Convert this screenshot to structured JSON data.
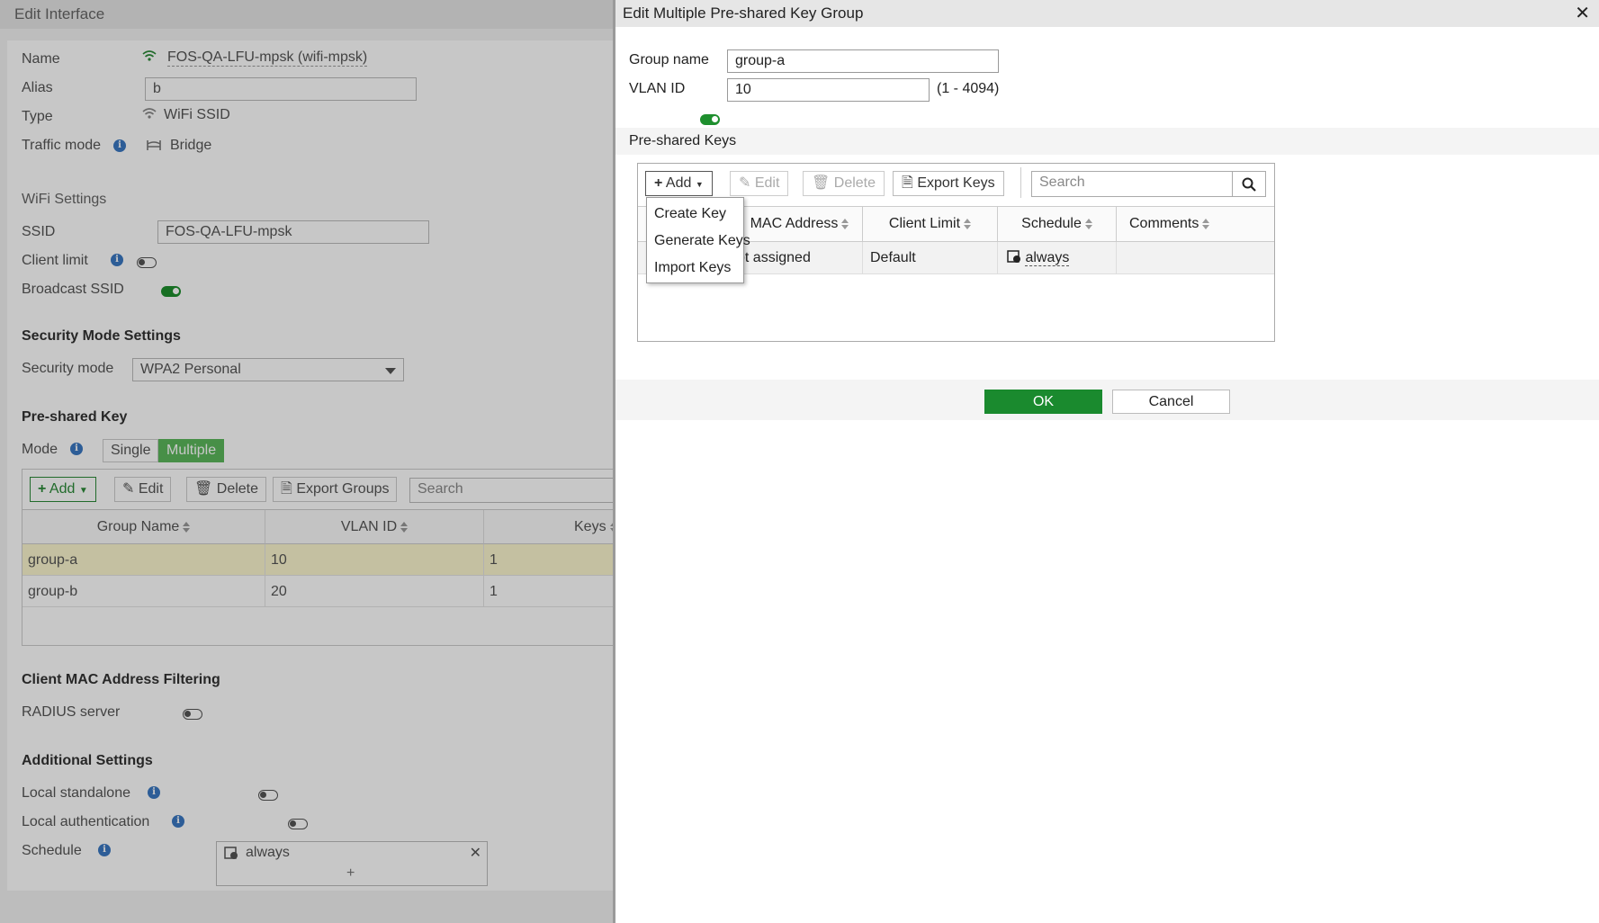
{
  "background_page": {
    "title": "Edit Interface",
    "name": {
      "label": "Name",
      "value": "FOS-QA-LFU-mpsk (wifi-mpsk)"
    },
    "alias": {
      "label": "Alias",
      "value": "b"
    },
    "type": {
      "label": "Type",
      "value": "WiFi SSID"
    },
    "traffic_mode": {
      "label": "Traffic mode",
      "value": "Bridge"
    },
    "wifi_settings": {
      "title": "WiFi Settings",
      "ssid": {
        "label": "SSID",
        "value": "FOS-QA-LFU-mpsk"
      },
      "client_limit": {
        "label": "Client limit",
        "enabled": false
      },
      "broadcast_ssid": {
        "label": "Broadcast SSID",
        "enabled": true
      }
    },
    "security_mode_settings": {
      "title": "Security Mode Settings",
      "security_mode": {
        "label": "Security mode",
        "value": "WPA2 Personal"
      }
    },
    "pre_shared_key": {
      "title": "Pre-shared Key",
      "mode_label": "Mode",
      "mode_options": [
        "Single",
        "Multiple"
      ],
      "mode_selected": "Multiple",
      "toolbar": {
        "add": "Add",
        "edit": "Edit",
        "delete": "Delete",
        "export": "Export Groups",
        "search_placeholder": "Search"
      },
      "columns": [
        "Group Name",
        "VLAN ID",
        "Keys"
      ],
      "rows": [
        {
          "group_name": "group-a",
          "vlan_id": "10",
          "keys": "1",
          "selected": true
        },
        {
          "group_name": "group-b",
          "vlan_id": "20",
          "keys": "1",
          "selected": false
        }
      ]
    },
    "client_mac_filtering": {
      "title": "Client MAC Address Filtering",
      "radius_server": {
        "label": "RADIUS server",
        "enabled": false
      }
    },
    "additional_settings": {
      "title": "Additional Settings",
      "local_standalone": {
        "label": "Local standalone",
        "enabled": false
      },
      "local_authentication": {
        "label": "Local authentication",
        "enabled": false
      },
      "schedule": {
        "label": "Schedule",
        "value": "always",
        "add": "+"
      }
    }
  },
  "dialog": {
    "title": "Edit Multiple Pre-shared Key Group",
    "close": "✕",
    "group_name": {
      "label": "Group name",
      "value": "group-a"
    },
    "vlan_id": {
      "label": "VLAN ID",
      "enabled": true,
      "value": "10",
      "range_hint": "(1 - 4094)"
    },
    "psk_section_title": "Pre-shared Keys",
    "toolbar": {
      "add": "Add",
      "edit": "Edit",
      "delete": "Delete",
      "export": "Export Keys",
      "search_placeholder": "Search"
    },
    "add_menu": [
      "Create Key",
      "Generate Keys",
      "Import Keys"
    ],
    "columns": [
      "MAC Address",
      "Client Limit",
      "Schedule",
      "Comments"
    ],
    "rows": [
      {
        "mac_address": "ot assigned",
        "client_limit": "Default",
        "schedule": "always",
        "comments": ""
      }
    ],
    "ok": "OK",
    "cancel": "Cancel"
  },
  "colors": {
    "accent_green": "#1a8a2e",
    "selected_row": "#fbf7cf",
    "mode_selected": "#5cb85c"
  }
}
